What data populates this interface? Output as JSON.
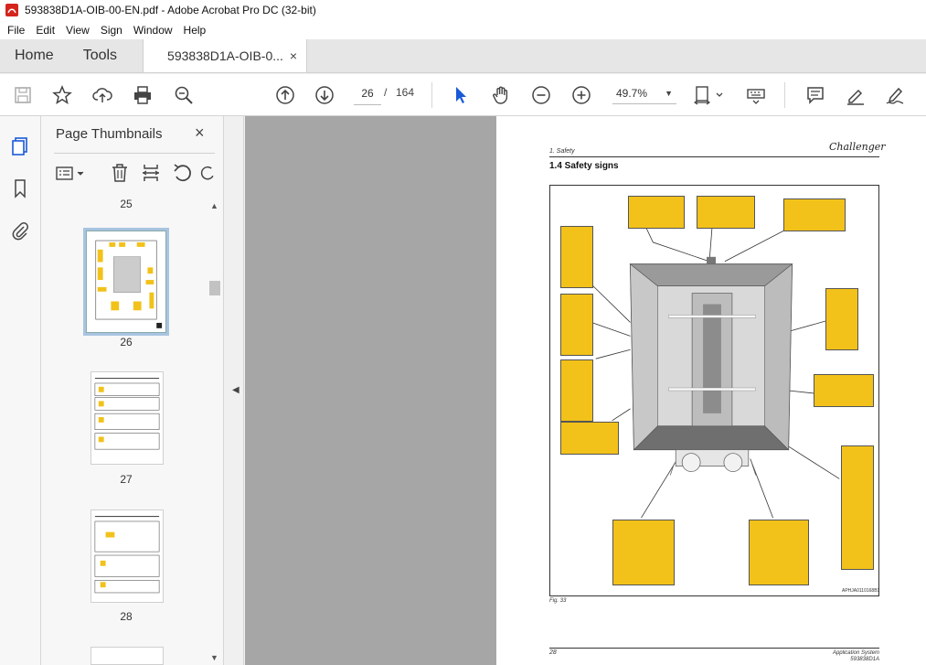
{
  "window": {
    "title": "593838D1A-OIB-00-EN.pdf - Adobe Acrobat Pro DC (32-bit)"
  },
  "menu": [
    "File",
    "Edit",
    "View",
    "Sign",
    "Window",
    "Help"
  ],
  "tabs": {
    "home": "Home",
    "tools": "Tools",
    "document": "593838D1A-OIB-0...",
    "close": "×"
  },
  "toolbar": {
    "current_page": "26",
    "page_separator": "/",
    "total_pages": "164",
    "zoom": "49.7%"
  },
  "panel": {
    "title": "Page Thumbnails",
    "close": "×",
    "page_labels": [
      "25",
      "26",
      "27",
      "28"
    ],
    "selected_page": "26"
  },
  "page": {
    "breadcrumb": "1. Safety",
    "brand": "Challenger",
    "heading": "1.4   Safety signs",
    "figure_code": "APHJA0110168B1",
    "figure_caption": "Fig. 33",
    "footer_page": "28",
    "footer_system": "Application System",
    "footer_code": "593838D1A"
  },
  "colors": {
    "decal_yellow": "#f2c21a",
    "doc_background": "#a6a6a6",
    "selected_outline": "#a8c4e0",
    "icon_blue": "#1a5ad7"
  }
}
